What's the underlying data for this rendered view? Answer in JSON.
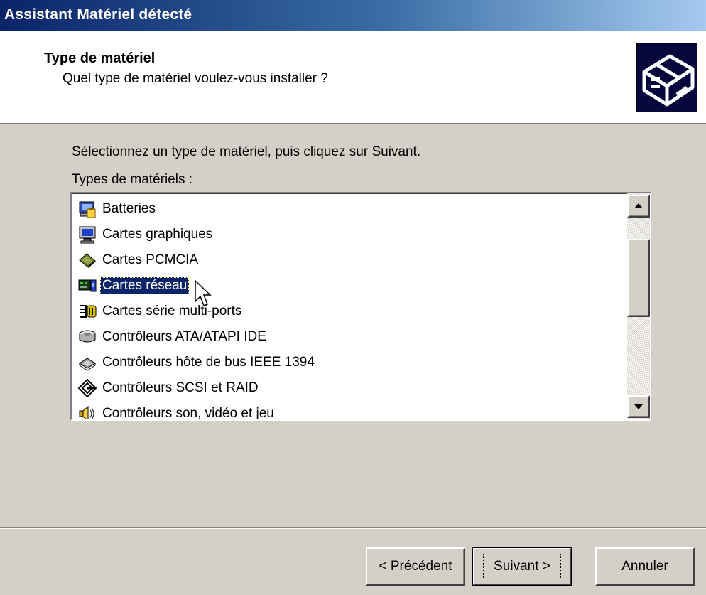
{
  "window": {
    "title": "Assistant Matériel détecté"
  },
  "header": {
    "title": "Type de matériel",
    "subtitle": "Quel type de matériel voulez-vous installer ?",
    "icon": "hardware-wizard-icon"
  },
  "body": {
    "instruction": "Sélectionnez un type de matériel, puis cliquez sur Suivant.",
    "list_label": "Types de matériels :"
  },
  "list": {
    "items": [
      {
        "label": "Batteries",
        "icon": "battery-icon"
      },
      {
        "label": "Cartes graphiques",
        "icon": "monitor-icon"
      },
      {
        "label": "Cartes PCMCIA",
        "icon": "pcmcia-card-icon"
      },
      {
        "label": "Cartes réseau",
        "icon": "network-card-icon",
        "selected": true
      },
      {
        "label": "Cartes série multi-ports",
        "icon": "multiport-serial-icon"
      },
      {
        "label": "Contrôleurs ATA/ATAPI IDE",
        "icon": "ide-controller-icon"
      },
      {
        "label": "Contrôleurs hôte de bus IEEE 1394",
        "icon": "ieee1394-icon"
      },
      {
        "label": "Contrôleurs SCSI et RAID",
        "icon": "scsi-icon"
      },
      {
        "label": "Contrôleurs son, vidéo et jeu",
        "icon": "speaker-icon"
      }
    ],
    "scroll_position": 0.3
  },
  "buttons": {
    "back": "< Précédent",
    "next": "Suivant >",
    "cancel": "Annuler"
  },
  "colors": {
    "titlebar_start": "#0a246a",
    "titlebar_end": "#a6caf0",
    "selection": "#0a246a",
    "face": "#d4d0c8"
  }
}
